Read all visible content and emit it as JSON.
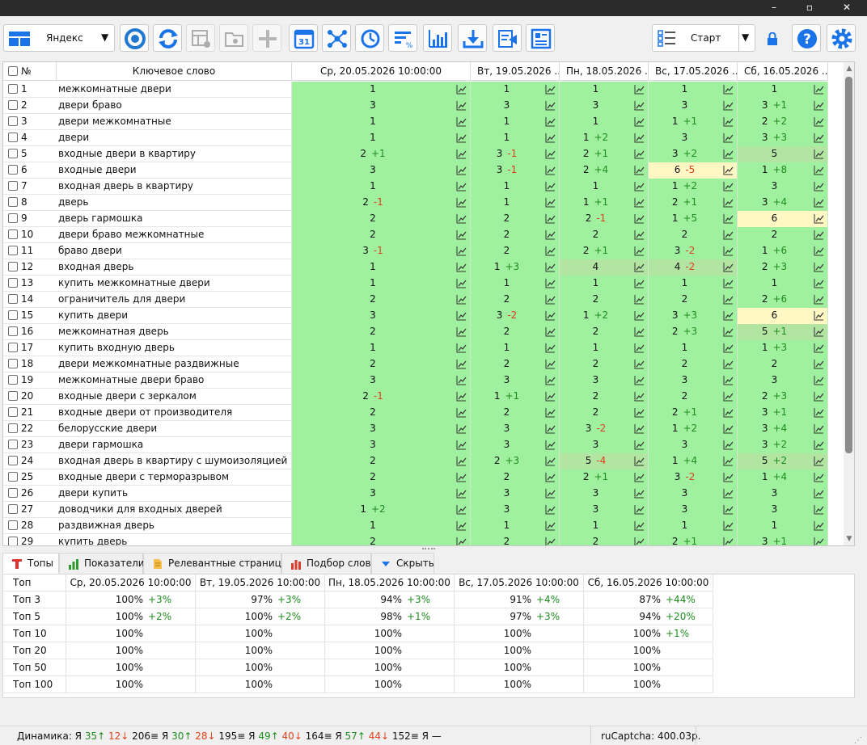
{
  "window": {
    "minimize": "–",
    "maximize": "▫",
    "close": "✕"
  },
  "toolbar": {
    "search_engine": "Яндекс",
    "start_label": "Старт",
    "calendar_day": "31",
    "colors": {
      "accent": "#1a73e8",
      "chrome_blue": "#1f77d0"
    }
  },
  "grid": {
    "headers": {
      "num": "№",
      "keyword": "Ключевое слово",
      "dates": [
        "Ср, 20.05.2026 10:00:00",
        "Вт, 19.05.2026 ...",
        "Пн, 18.05.2026 ...",
        "Вс, 17.05.2026 ...",
        "Сб, 16.05.2026 ..."
      ]
    },
    "colors": {
      "green": "#9ff09f",
      "yellow": "#fff8c4",
      "olive": "#b2e5a2",
      "up": "#1e8c1e",
      "down": "#e2401c"
    },
    "rows": [
      {
        "num": "1",
        "kw": "межкомнатные двери",
        "c": [
          [
            "1",
            "",
            "g"
          ],
          [
            "1",
            "",
            "g"
          ],
          [
            "1",
            "",
            "g"
          ],
          [
            "1",
            "",
            "g"
          ],
          [
            "1",
            "",
            "g"
          ]
        ]
      },
      {
        "num": "2",
        "kw": "двери браво",
        "c": [
          [
            "3",
            "",
            "g"
          ],
          [
            "3",
            "",
            "g"
          ],
          [
            "3",
            "",
            "g"
          ],
          [
            "3",
            "",
            "g"
          ],
          [
            "3",
            "+1",
            "g"
          ]
        ]
      },
      {
        "num": "3",
        "kw": "двери межкомнатные",
        "c": [
          [
            "1",
            "",
            "g"
          ],
          [
            "1",
            "",
            "g"
          ],
          [
            "1",
            "",
            "g"
          ],
          [
            "1",
            "+1",
            "g"
          ],
          [
            "2",
            "+2",
            "g"
          ]
        ]
      },
      {
        "num": "4",
        "kw": "двери",
        "c": [
          [
            "1",
            "",
            "g"
          ],
          [
            "1",
            "",
            "g"
          ],
          [
            "1",
            "+2",
            "g"
          ],
          [
            "3",
            "",
            "g"
          ],
          [
            "3",
            "+3",
            "g"
          ]
        ]
      },
      {
        "num": "5",
        "kw": "входные двери в квартиру",
        "c": [
          [
            "2",
            "+1",
            "g"
          ],
          [
            "3",
            "-1",
            "g"
          ],
          [
            "2",
            "+1",
            "g"
          ],
          [
            "3",
            "+2",
            "g"
          ],
          [
            "5",
            "",
            "o"
          ]
        ]
      },
      {
        "num": "6",
        "kw": "входные двери",
        "c": [
          [
            "3",
            "",
            "g"
          ],
          [
            "3",
            "-1",
            "g"
          ],
          [
            "2",
            "+4",
            "g"
          ],
          [
            "6",
            "-5",
            "y"
          ],
          [
            "1",
            "+8",
            "g"
          ]
        ]
      },
      {
        "num": "7",
        "kw": "входная дверь в квартиру",
        "c": [
          [
            "1",
            "",
            "g"
          ],
          [
            "1",
            "",
            "g"
          ],
          [
            "1",
            "",
            "g"
          ],
          [
            "1",
            "+2",
            "g"
          ],
          [
            "3",
            "",
            "g"
          ]
        ]
      },
      {
        "num": "8",
        "kw": "дверь",
        "c": [
          [
            "2",
            "-1",
            "g"
          ],
          [
            "1",
            "",
            "g"
          ],
          [
            "1",
            "+1",
            "g"
          ],
          [
            "2",
            "+1",
            "g"
          ],
          [
            "3",
            "+4",
            "g"
          ]
        ]
      },
      {
        "num": "9",
        "kw": "дверь гармошка",
        "c": [
          [
            "2",
            "",
            "g"
          ],
          [
            "2",
            "",
            "g"
          ],
          [
            "2",
            "-1",
            "g"
          ],
          [
            "1",
            "+5",
            "g"
          ],
          [
            "6",
            "",
            "y"
          ]
        ]
      },
      {
        "num": "10",
        "kw": "двери браво межкомнатные",
        "c": [
          [
            "2",
            "",
            "g"
          ],
          [
            "2",
            "",
            "g"
          ],
          [
            "2",
            "",
            "g"
          ],
          [
            "2",
            "",
            "g"
          ],
          [
            "2",
            "",
            "g"
          ]
        ]
      },
      {
        "num": "11",
        "kw": "браво двери",
        "c": [
          [
            "3",
            "-1",
            "g"
          ],
          [
            "2",
            "",
            "g"
          ],
          [
            "2",
            "+1",
            "g"
          ],
          [
            "3",
            "-2",
            "g"
          ],
          [
            "1",
            "+6",
            "g"
          ]
        ]
      },
      {
        "num": "12",
        "kw": "входная дверь",
        "c": [
          [
            "1",
            "",
            "g"
          ],
          [
            "1",
            "+3",
            "g"
          ],
          [
            "4",
            "",
            "o"
          ],
          [
            "4",
            "-2",
            "o"
          ],
          [
            "2",
            "+3",
            "g"
          ]
        ]
      },
      {
        "num": "13",
        "kw": "купить межкомнатные двери",
        "c": [
          [
            "1",
            "",
            "g"
          ],
          [
            "1",
            "",
            "g"
          ],
          [
            "1",
            "",
            "g"
          ],
          [
            "1",
            "",
            "g"
          ],
          [
            "1",
            "",
            "g"
          ]
        ]
      },
      {
        "num": "14",
        "kw": "ограничитель для двери",
        "c": [
          [
            "2",
            "",
            "g"
          ],
          [
            "2",
            "",
            "g"
          ],
          [
            "2",
            "",
            "g"
          ],
          [
            "2",
            "",
            "g"
          ],
          [
            "2",
            "+6",
            "g"
          ]
        ]
      },
      {
        "num": "15",
        "kw": "купить двери",
        "c": [
          [
            "3",
            "",
            "g"
          ],
          [
            "3",
            "-2",
            "g"
          ],
          [
            "1",
            "+2",
            "g"
          ],
          [
            "3",
            "+3",
            "g"
          ],
          [
            "6",
            "",
            "y"
          ]
        ]
      },
      {
        "num": "16",
        "kw": "межкомнатная дверь",
        "c": [
          [
            "2",
            "",
            "g"
          ],
          [
            "2",
            "",
            "g"
          ],
          [
            "2",
            "",
            "g"
          ],
          [
            "2",
            "+3",
            "g"
          ],
          [
            "5",
            "+1",
            "o"
          ]
        ]
      },
      {
        "num": "17",
        "kw": "купить входную дверь",
        "c": [
          [
            "1",
            "",
            "g"
          ],
          [
            "1",
            "",
            "g"
          ],
          [
            "1",
            "",
            "g"
          ],
          [
            "1",
            "",
            "g"
          ],
          [
            "1",
            "+3",
            "g"
          ]
        ]
      },
      {
        "num": "18",
        "kw": "двери межкомнатные раздвижные",
        "c": [
          [
            "2",
            "",
            "g"
          ],
          [
            "2",
            "",
            "g"
          ],
          [
            "2",
            "",
            "g"
          ],
          [
            "2",
            "",
            "g"
          ],
          [
            "2",
            "",
            "g"
          ]
        ]
      },
      {
        "num": "19",
        "kw": "межкомнатные двери браво",
        "c": [
          [
            "3",
            "",
            "g"
          ],
          [
            "3",
            "",
            "g"
          ],
          [
            "3",
            "",
            "g"
          ],
          [
            "3",
            "",
            "g"
          ],
          [
            "3",
            "",
            "g"
          ]
        ]
      },
      {
        "num": "20",
        "kw": "входные двери с зеркалом",
        "c": [
          [
            "2",
            "-1",
            "g"
          ],
          [
            "1",
            "+1",
            "g"
          ],
          [
            "2",
            "",
            "g"
          ],
          [
            "2",
            "",
            "g"
          ],
          [
            "2",
            "+3",
            "g"
          ]
        ]
      },
      {
        "num": "21",
        "kw": "входные двери от производителя",
        "c": [
          [
            "2",
            "",
            "g"
          ],
          [
            "2",
            "",
            "g"
          ],
          [
            "2",
            "",
            "g"
          ],
          [
            "2",
            "+1",
            "g"
          ],
          [
            "3",
            "+1",
            "g"
          ]
        ]
      },
      {
        "num": "22",
        "kw": "белорусские двери",
        "c": [
          [
            "3",
            "",
            "g"
          ],
          [
            "3",
            "",
            "g"
          ],
          [
            "3",
            "-2",
            "g"
          ],
          [
            "1",
            "+2",
            "g"
          ],
          [
            "3",
            "+4",
            "g"
          ]
        ]
      },
      {
        "num": "23",
        "kw": "двери гармошка",
        "c": [
          [
            "3",
            "",
            "g"
          ],
          [
            "3",
            "",
            "g"
          ],
          [
            "3",
            "",
            "g"
          ],
          [
            "3",
            "",
            "g"
          ],
          [
            "3",
            "+2",
            "g"
          ]
        ]
      },
      {
        "num": "24",
        "kw": "входная дверь в квартиру с шумоизоляцией",
        "c": [
          [
            "2",
            "",
            "g"
          ],
          [
            "2",
            "+3",
            "g"
          ],
          [
            "5",
            "-4",
            "o"
          ],
          [
            "1",
            "+4",
            "g"
          ],
          [
            "5",
            "+2",
            "o"
          ]
        ]
      },
      {
        "num": "25",
        "kw": "входные двери с терморазрывом",
        "c": [
          [
            "2",
            "",
            "g"
          ],
          [
            "2",
            "",
            "g"
          ],
          [
            "2",
            "+1",
            "g"
          ],
          [
            "3",
            "-2",
            "g"
          ],
          [
            "1",
            "+4",
            "g"
          ]
        ]
      },
      {
        "num": "26",
        "kw": "двери купить",
        "c": [
          [
            "3",
            "",
            "g"
          ],
          [
            "3",
            "",
            "g"
          ],
          [
            "3",
            "",
            "g"
          ],
          [
            "3",
            "",
            "g"
          ],
          [
            "3",
            "",
            "g"
          ]
        ]
      },
      {
        "num": "27",
        "kw": "доводчики для входных дверей",
        "c": [
          [
            "1",
            "+2",
            "g"
          ],
          [
            "3",
            "",
            "g"
          ],
          [
            "3",
            "",
            "g"
          ],
          [
            "3",
            "",
            "g"
          ],
          [
            "3",
            "",
            "g"
          ]
        ]
      },
      {
        "num": "28",
        "kw": "раздвижная дверь",
        "c": [
          [
            "1",
            "",
            "g"
          ],
          [
            "1",
            "",
            "g"
          ],
          [
            "1",
            "",
            "g"
          ],
          [
            "1",
            "",
            "g"
          ],
          [
            "1",
            "",
            "g"
          ]
        ]
      },
      {
        "num": "29",
        "kw": "купить дверь",
        "c": [
          [
            "2",
            "",
            "g"
          ],
          [
            "2",
            "",
            "g"
          ],
          [
            "2",
            "",
            "g"
          ],
          [
            "2",
            "+1",
            "g"
          ],
          [
            "3",
            "+1",
            "g"
          ]
        ]
      }
    ]
  },
  "tabs": [
    {
      "label": "Топы",
      "icon": "tops-icon"
    },
    {
      "label": "Показатели",
      "icon": "bars-icon"
    },
    {
      "label": "Релевантные страницы",
      "icon": "document-icon"
    },
    {
      "label": "Подбор слов",
      "icon": "chart-icon"
    },
    {
      "label": "Скрыть",
      "icon": "hide-arrow-icon"
    }
  ],
  "tops": {
    "header": [
      "Топ",
      "Ср, 20.05.2026 10:00:00",
      "Вт, 19.05.2026 10:00:00",
      "Пн, 18.05.2026 10:00:00",
      "Вс, 17.05.2026 10:00:00",
      "Сб, 16.05.2026 10:00:00"
    ],
    "rows": [
      {
        "label": "Топ 3",
        "v": [
          [
            "100%",
            "+3%"
          ],
          [
            "97%",
            "+3%"
          ],
          [
            "94%",
            "+3%"
          ],
          [
            "91%",
            "+4%"
          ],
          [
            "87%",
            "+44%"
          ]
        ]
      },
      {
        "label": "Топ 5",
        "v": [
          [
            "100%",
            "+2%"
          ],
          [
            "100%",
            "+2%"
          ],
          [
            "98%",
            "+1%"
          ],
          [
            "97%",
            "+3%"
          ],
          [
            "94%",
            "+20%"
          ]
        ]
      },
      {
        "label": "Топ 10",
        "v": [
          [
            "100%",
            ""
          ],
          [
            "100%",
            ""
          ],
          [
            "100%",
            ""
          ],
          [
            "100%",
            ""
          ],
          [
            "100%",
            "+1%"
          ]
        ]
      },
      {
        "label": "Топ 20",
        "v": [
          [
            "100%",
            ""
          ],
          [
            "100%",
            ""
          ],
          [
            "100%",
            ""
          ],
          [
            "100%",
            ""
          ],
          [
            "100%",
            ""
          ]
        ]
      },
      {
        "label": "Топ 50",
        "v": [
          [
            "100%",
            ""
          ],
          [
            "100%",
            ""
          ],
          [
            "100%",
            ""
          ],
          [
            "100%",
            ""
          ],
          [
            "100%",
            ""
          ]
        ]
      },
      {
        "label": "Топ 100",
        "v": [
          [
            "100%",
            ""
          ],
          [
            "100%",
            ""
          ],
          [
            "100%",
            ""
          ],
          [
            "100%",
            ""
          ],
          [
            "100%",
            ""
          ]
        ]
      }
    ]
  },
  "status": {
    "dynamics": [
      {
        "t": "Динамика: Я ",
        "c": ""
      },
      {
        "t": "35↑",
        "c": "up"
      },
      {
        "t": " ",
        "c": ""
      },
      {
        "t": "12↓",
        "c": "dn"
      },
      {
        "t": " 206≡ Я ",
        "c": ""
      },
      {
        "t": "30↑",
        "c": "up"
      },
      {
        "t": " ",
        "c": ""
      },
      {
        "t": "28↓",
        "c": "dn"
      },
      {
        "t": " 195≡ Я ",
        "c": ""
      },
      {
        "t": "49↑",
        "c": "up"
      },
      {
        "t": " ",
        "c": ""
      },
      {
        "t": "40↓",
        "c": "dn"
      },
      {
        "t": " 164≡ Я ",
        "c": ""
      },
      {
        "t": "57↑",
        "c": "up"
      },
      {
        "t": " ",
        "c": ""
      },
      {
        "t": "44↓",
        "c": "dn"
      },
      {
        "t": " 152≡ Я —",
        "c": ""
      }
    ],
    "captcha": "ruCaptcha: 400.03р."
  }
}
